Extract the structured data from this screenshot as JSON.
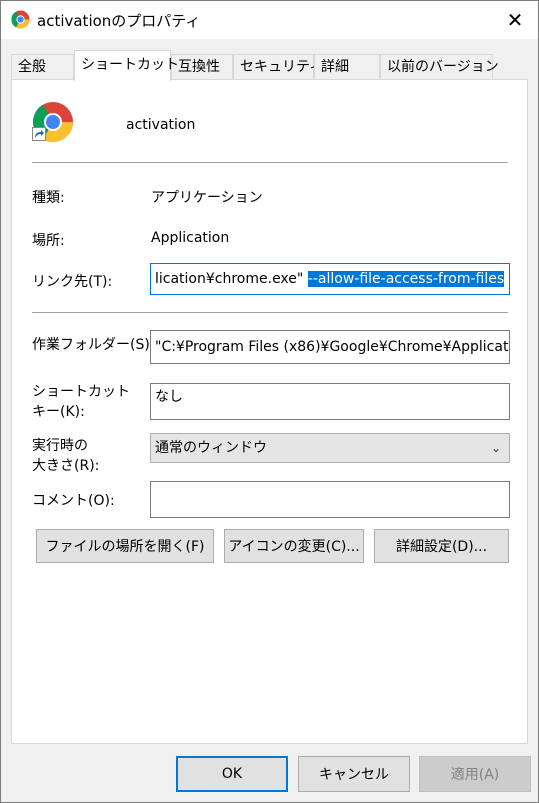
{
  "window": {
    "title": "activationのプロパティ"
  },
  "tabs": [
    "全般",
    "ショートカット",
    "互換性",
    "セキュリティ",
    "詳細",
    "以前のバージョン"
  ],
  "shortcut": {
    "name": "activation",
    "type_label": "種類:",
    "type_value": "アプリケーション",
    "location_label": "場所:",
    "location_value": "Application",
    "target_label": "リンク先(T):",
    "target_value_plain": "lication¥chrome.exe\" ",
    "target_value_selected": "--allow-file-access-from-files",
    "workdir_label": "作業フォルダー(S):",
    "workdir_value": "\"C:¥Program Files (x86)¥Google¥Chrome¥Applicat",
    "hotkey_label_line1": "ショートカット",
    "hotkey_label_line2": "キー(K):",
    "hotkey_value": "なし",
    "run_label_line1": "実行時の",
    "run_label_line2": "大きさ(R):",
    "run_value": "通常のウィンドウ",
    "comment_label": "コメント(O):",
    "comment_value": ""
  },
  "buttons": {
    "open_location": "ファイルの場所を開く(F)",
    "change_icon": "アイコンの変更(C)...",
    "advanced": "詳細設定(D)..."
  },
  "footer": {
    "ok": "OK",
    "cancel": "キャンセル",
    "apply": "適用(A)"
  },
  "icons": {
    "app": "chrome-icon",
    "close": "close-icon",
    "shortcut": "shortcut-arrow-icon",
    "dropdown": "chevron-down-icon"
  },
  "colors": {
    "selection": "#0078d7",
    "default_button_border": "#0078d7"
  }
}
